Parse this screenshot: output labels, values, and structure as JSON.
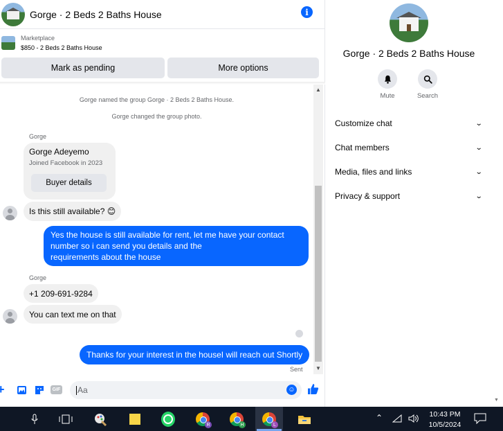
{
  "header": {
    "title": "Gorge · 2 Beds 2 Baths House"
  },
  "marketplace": {
    "label": "Marketplace",
    "listing": "$850 - 2 Beds 2 Baths House"
  },
  "buttons": {
    "mark_pending": "Mark as pending",
    "more_options": "More options"
  },
  "messages": {
    "system_1": "Gorge named the group Gorge · 2 Beds 2 Baths House.",
    "system_2": "Gorge changed the group photo.",
    "sender_1": "Gorge",
    "card_name": "Gorge Adeyemo",
    "card_sub": "Joined Facebook in 2023",
    "card_button": "Buyer details",
    "msg_in_1": "Is this still available? 😊",
    "msg_out_1_line1": "Yes the house is still available for rent, let me have your contact",
    "msg_out_1_line2": "number so i can send you details and the",
    "msg_out_1_line3": "requirements about the house",
    "sender_2": "Gorge",
    "msg_in_2": "+1 209-691-9284",
    "msg_in_3": "You can text me on that",
    "msg_out_2": "Thanks for your interest in the houseI will reach out Shortly",
    "status": "Sent"
  },
  "composer": {
    "placeholder": "Aa"
  },
  "side": {
    "title": "Gorge · 2 Beds 2 Baths House",
    "mute_label": "Mute",
    "search_label": "Search",
    "menu": [
      "Customize chat",
      "Chat members",
      "Media, files and links",
      "Privacy & support"
    ]
  },
  "taskbar": {
    "time": "10:43 PM",
    "date": "10/5/2024",
    "chrome_badges": [
      "R",
      "H",
      "L"
    ]
  },
  "colors": {
    "accent": "#0866ff",
    "bubble_in": "#f0f0f0",
    "taskbar": "#0f1725"
  }
}
